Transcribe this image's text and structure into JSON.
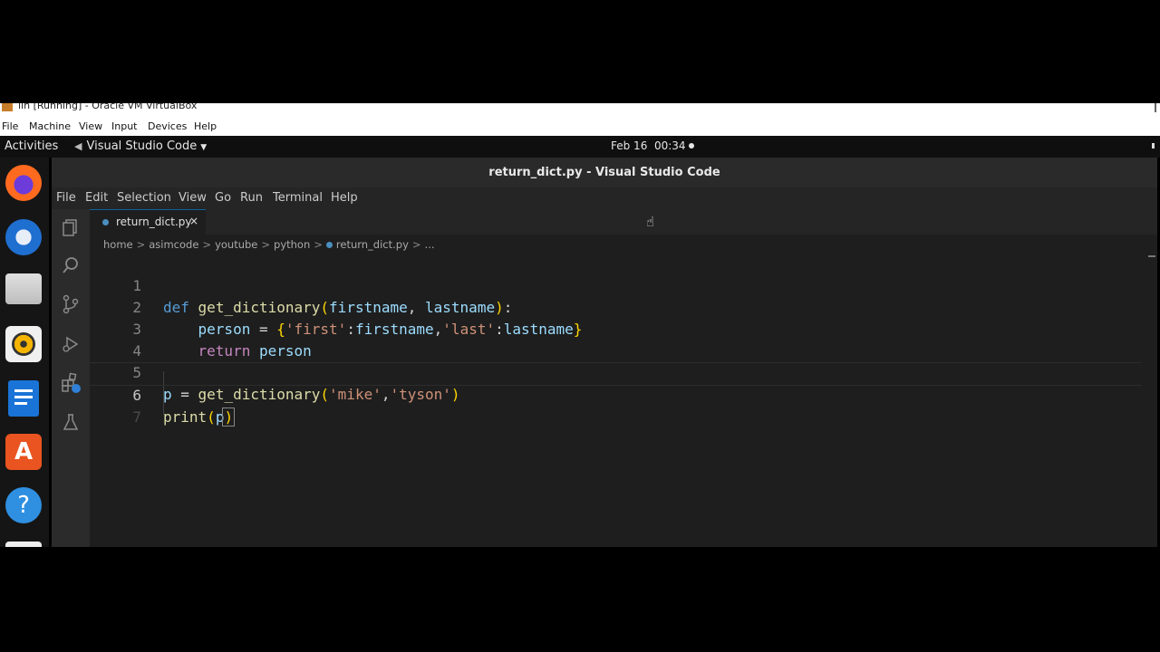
{
  "vbox": {
    "title": "lin [Running] - Oracle VM VirtualBox",
    "menu": [
      "File",
      "Machine",
      "View",
      "Input",
      "Devices",
      "Help"
    ]
  },
  "topbar": {
    "activities": "Activities",
    "app": "Visual Studio Code",
    "date": "Feb 16",
    "time": "00:34"
  },
  "dock": {
    "icons": [
      "firefox-icon",
      "thunderbird-icon",
      "files-icon",
      "rhythmbox-icon",
      "writer-icon",
      "software-icon",
      "help-icon"
    ]
  },
  "vscode": {
    "title": "return_dict.py - Visual Studio Code",
    "menu": [
      "File",
      "Edit",
      "Selection",
      "View",
      "Go",
      "Run",
      "Terminal",
      "Help"
    ],
    "tab": {
      "name": "return_dict.py",
      "close": "×"
    },
    "breadcrumb": [
      "home",
      "asimcode",
      "youtube",
      "python",
      "return_dict.py",
      "..."
    ],
    "lines": [
      {
        "n": "1"
      },
      {
        "n": "2"
      },
      {
        "n": "3"
      },
      {
        "n": "4"
      },
      {
        "n": "5"
      },
      {
        "n": "6"
      },
      {
        "n": "7"
      }
    ],
    "code": {
      "l1": {
        "def": "def",
        "fn": "get_dictionary",
        "open": "(",
        "p1": "firstname",
        "comma": ", ",
        "p2": "lastname",
        "close": ")",
        "colon": ":"
      },
      "l2": {
        "indent": "    ",
        "var": "person",
        "eq": " = ",
        "lb": "{",
        "s1": "'first'",
        "c1": ":",
        "v1": "firstname",
        "comma": ",",
        "s2": "'last'",
        "c2": ":",
        "v2": "lastname",
        "rb": "}"
      },
      "l3": {
        "indent": "    ",
        "kw": "return",
        "sp": " ",
        "var": "person"
      },
      "l5": {
        "var": "p",
        "eq": " = ",
        "fn": "get_dictionary",
        "open": "(",
        "s1": "'mike'",
        "comma": ",",
        "s2": "'tyson'",
        "close": ")"
      },
      "l6": {
        "fn": "print",
        "open": "(",
        "arg": "p",
        "close": ")"
      }
    }
  },
  "colors": {
    "keyword": "#569cd6",
    "function": "#dcdcaa",
    "parameter": "#9cdcfe",
    "string": "#ce9178"
  }
}
